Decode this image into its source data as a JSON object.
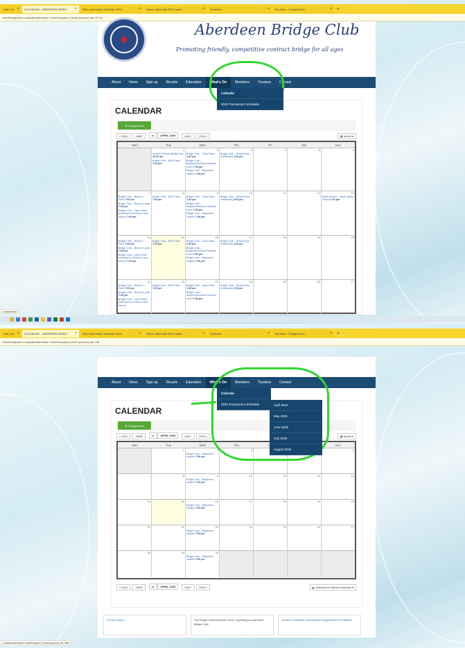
{
  "browser": {
    "tabs": [
      "mail | Ini",
      "CALENDAR – ABERDEEN BRIDG",
      "SBU and District Calendar 2024",
      "Home | Microsoft 365 Copilot",
      "OneDrive",
      "My Drive - Google Drive"
    ],
    "url1": "deenbridgeclub.co.uk/calendar/action~month/request_format~json/cat_ids~27,16",
    "url2": "deenbridgeclub.co.uk/calendar/action~month/request_format~json/cat_ids~28/",
    "status1": "o.uk/calendar/",
    "status2": "o.uk/calendar/action~month/request_format~json/cat_ids~28/#"
  },
  "site": {
    "title": "Aberdeen Bridge Club",
    "tagline": "Promoting friendly, competitive contract bridge for all ages",
    "nav": [
      "About",
      "News",
      "Sign up",
      "Results",
      "Education",
      "What's On",
      "Members",
      "Trustees",
      "Contact"
    ]
  },
  "dropdown": [
    "Calendar",
    "2025 Tournament Schedule"
  ],
  "submenu": [
    "April 2025",
    "May 2025",
    "June 2025",
    "July 2025",
    "August 2025"
  ],
  "calendar": {
    "title": "CALENDAR",
    "categories": "Categories",
    "prev_year": "« 2024",
    "prev_month": "‹ MAR",
    "month": "APRIL 2025",
    "next_month": "MAY ›",
    "next_year": "2026 »",
    "view": "Month",
    "subscribe": "Subscribe to filtered calendar",
    "days": [
      "Mon",
      "Tue",
      "Wed",
      "Thu",
      "Fri",
      "Sat",
      "Sun"
    ]
  },
  "events": {
    "bronze1": "Bridge Club – Bronze 1 Pairs",
    "bronze2": "Bridge Club – Bronze 2 pairs",
    "open_bronze": "Bridge Club – Open Pairs (intended for Bronze 3 and above)",
    "bbo": "Bridge Club – BBO Pairs",
    "open": "Bridge Club – Open Pairs",
    "beginner_novice": "Bridge Club – Beginner/Novices Relaxed event",
    "beginners_classes": "Bridge Club – Beginners classes",
    "relaxed": "Bridge Club – Relaxed (for individuals)",
    "robson": "Andrew Robson Bridge Day",
    "north_district": "North District – Jamie Batey Teams",
    "t700": "7:00 pm",
    "t130": "1:30 pm",
    "t200": "2:00 pm",
    "t1000": "10:00 am",
    "t120": "1:20 pm"
  },
  "footer": {
    "privacy": "Privacy Notice",
    "operating": "The Bridge Club Aberdeen SCIO, operating as Aberdeen Bridge Club",
    "charity": "Scottish Charitable Incorporated Organisation SC04864S"
  }
}
